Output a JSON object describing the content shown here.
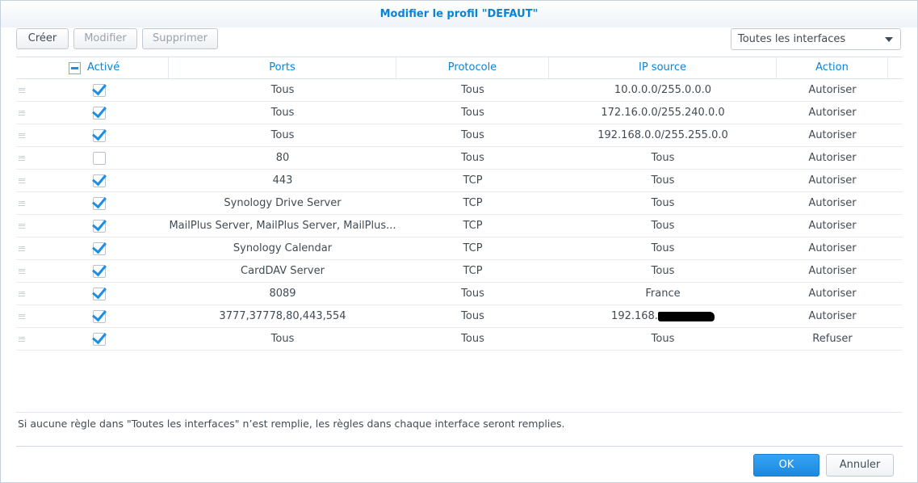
{
  "dialog": {
    "title": "Modifier le profil \"DEFAUT\""
  },
  "toolbar": {
    "create_label": "Créer",
    "modify_label": "Modifier",
    "delete_label": "Supprimer",
    "interface_select": "Toutes les interfaces"
  },
  "table": {
    "headers": {
      "enabled": "Activé",
      "ports": "Ports",
      "protocol": "Protocole",
      "source_ip": "IP source",
      "action": "Action"
    },
    "rows": [
      {
        "enabled": true,
        "ports": "Tous",
        "protocol": "Tous",
        "source_ip": "10.0.0.0/255.0.0.0",
        "action": "Autoriser"
      },
      {
        "enabled": true,
        "ports": "Tous",
        "protocol": "Tous",
        "source_ip": "172.16.0.0/255.240.0.0",
        "action": "Autoriser"
      },
      {
        "enabled": true,
        "ports": "Tous",
        "protocol": "Tous",
        "source_ip": "192.168.0.0/255.255.0.0",
        "action": "Autoriser"
      },
      {
        "enabled": false,
        "ports": "80",
        "protocol": "Tous",
        "source_ip": "Tous",
        "action": "Autoriser"
      },
      {
        "enabled": true,
        "ports": "443",
        "protocol": "TCP",
        "source_ip": "Tous",
        "action": "Autoriser"
      },
      {
        "enabled": true,
        "ports": "Synology Drive Server",
        "protocol": "TCP",
        "source_ip": "Tous",
        "action": "Autoriser"
      },
      {
        "enabled": true,
        "ports": "MailPlus Server, MailPlus Server, MailPlus...",
        "protocol": "TCP",
        "source_ip": "Tous",
        "action": "Autoriser"
      },
      {
        "enabled": true,
        "ports": "Synology Calendar",
        "protocol": "TCP",
        "source_ip": "Tous",
        "action": "Autoriser"
      },
      {
        "enabled": true,
        "ports": "CardDAV Server",
        "protocol": "TCP",
        "source_ip": "Tous",
        "action": "Autoriser"
      },
      {
        "enabled": true,
        "ports": "8089",
        "protocol": "Tous",
        "source_ip": "France",
        "action": "Autoriser"
      },
      {
        "enabled": true,
        "ports": "3777,37778,80,443,554",
        "protocol": "Tous",
        "source_ip": "192.168.",
        "source_ip_redacted": true,
        "action": "Autoriser"
      },
      {
        "enabled": true,
        "ports": "Tous",
        "protocol": "Tous",
        "source_ip": "Tous",
        "action": "Refuser"
      }
    ]
  },
  "footer_note": "Si aucune règle dans \"Toutes les interfaces\" n’est remplie, les règles dans chaque interface seront remplies.",
  "buttons": {
    "ok": "OK",
    "cancel": "Annuler"
  },
  "colors": {
    "accent": "#0a83d6",
    "ok_button": "#1a88e0",
    "checkbox": "#1a8fe3"
  }
}
